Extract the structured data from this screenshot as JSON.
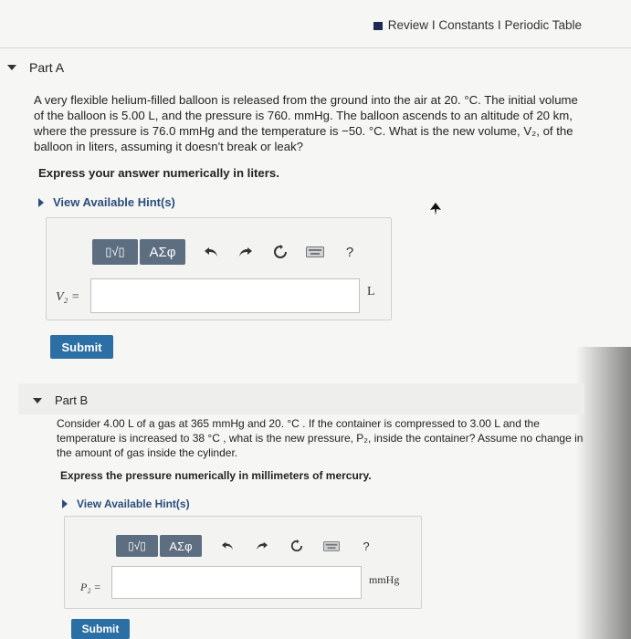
{
  "header": {
    "links": [
      "Review",
      "Constants",
      "Periodic Table"
    ],
    "separator": "I"
  },
  "partA": {
    "title": "Part A",
    "problem": "A very flexible helium-filled balloon is released from the ground into the air at 20. °C. The initial volume of the balloon is 5.00 L, and the pressure is 760. mmHg. The balloon ascends to an altitude of 20 km, where the pressure is 76.0 mmHg and the temperature is −50. °C. What is the new volume, V₂, of the balloon in liters, assuming it doesn't break or leak?",
    "instruction": "Express your answer numerically in liters.",
    "hint": "View Available Hint(s)",
    "variable": "V₂ =",
    "unit": "L",
    "input_value": "",
    "submit": "Submit"
  },
  "partB": {
    "title": "Part B",
    "problem": "Consider 4.00 L of a gas at 365 mmHg and 20. °C . If the container is compressed to 3.00 L and the temperature is increased to 38 °C , what is the new pressure, P₂, inside the container? Assume no change in the amount of gas inside the cylinder.",
    "instruction": "Express the pressure numerically in millimeters of mercury.",
    "hint": "View Available Hint(s)",
    "variable": "P₂ =",
    "unit": "mmHg",
    "input_value": "",
    "submit": "Submit"
  },
  "toolbar": {
    "template_label": "▯√▯",
    "greek_label": "ΑΣφ",
    "help_label": "?",
    "icons": [
      "undo-icon",
      "redo-icon",
      "reset-icon",
      "keyboard-icon",
      "help-icon"
    ]
  }
}
